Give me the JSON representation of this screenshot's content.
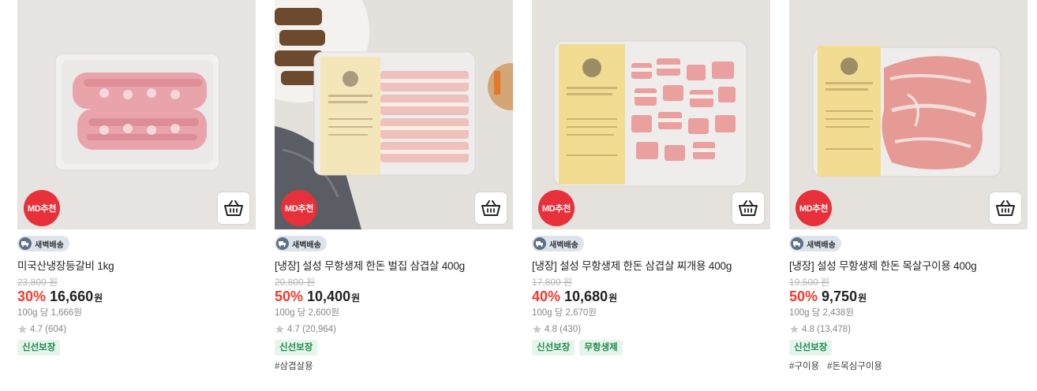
{
  "colors": {
    "discount": "#f03a2e",
    "md_badge": "#e8303a",
    "tag_bg": "#e6f5ec",
    "tag_text": "#1f8a4c"
  },
  "products": [
    {
      "md_label": "MD추천",
      "delivery": "새벽배송",
      "name": "미국산냉장등갈비 1kg",
      "original_price": "23,800 원",
      "discount": "30%",
      "price": "16,660",
      "currency": "원",
      "unit_price": "100g 당 1,666원",
      "rating": "4.7 (604)",
      "tags": [
        "신선보장"
      ],
      "hashtags": []
    },
    {
      "md_label": "MD추천",
      "delivery": "새벽배송",
      "name": "[냉장] 설성 무항생제 한돈 벌집 삼겹살 400g",
      "original_price": "20,800 원",
      "discount": "50%",
      "price": "10,400",
      "currency": "원",
      "unit_price": "100g 당 2,600원",
      "rating": "4.7 (20,964)",
      "tags": [
        "신선보장"
      ],
      "hashtags": [
        "#삼겹살용"
      ]
    },
    {
      "md_label": "MD추천",
      "delivery": "새벽배송",
      "name": "[냉장] 설성 무항생제 한돈 삼겹살 찌개용 400g",
      "original_price": "17,800 원",
      "discount": "40%",
      "price": "10,680",
      "currency": "원",
      "unit_price": "100g 당 2,670원",
      "rating": "4.8 (430)",
      "tags": [
        "신선보장",
        "무항생제"
      ],
      "hashtags": []
    },
    {
      "md_label": "MD추천",
      "delivery": "새벽배송",
      "name": "[냉장] 설성 무항생제 한돈 목살구이용 400g",
      "original_price": "19,500 원",
      "discount": "50%",
      "price": "9,750",
      "currency": "원",
      "unit_price": "100g 당 2,438원",
      "rating": "4.8 (13,478)",
      "tags": [
        "신선보장"
      ],
      "hashtags": [
        "#구이용",
        "#돈목심구이용"
      ]
    }
  ]
}
